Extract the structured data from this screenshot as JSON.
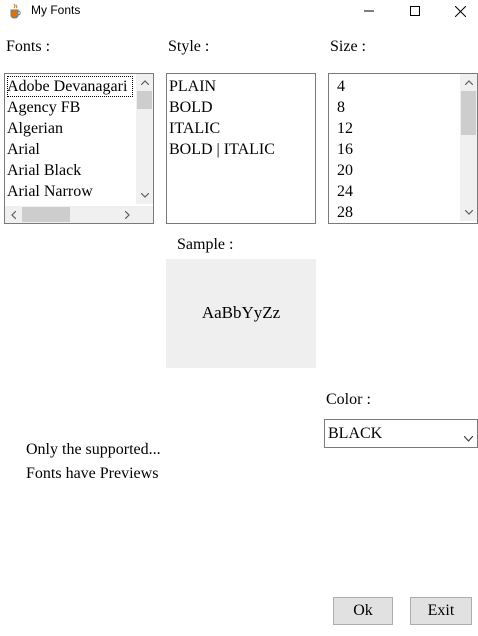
{
  "window": {
    "title": "My Fonts"
  },
  "labels": {
    "fonts": "Fonts :",
    "style": "Style :",
    "size": "Size :",
    "sample": "Sample :",
    "color": "Color :"
  },
  "fonts_list": {
    "items": [
      "Adobe Devanagari",
      "Agency FB",
      "Algerian",
      "Arial",
      "Arial Black",
      "Arial Narrow"
    ],
    "selected": "Adobe Devanagari"
  },
  "style_list": {
    "items": [
      "PLAIN",
      "BOLD",
      "ITALIC",
      "BOLD | ITALIC"
    ]
  },
  "size_list": {
    "items": [
      "4",
      "8",
      "12",
      "16",
      "20",
      "24",
      "28"
    ]
  },
  "sample": {
    "text": "AaBbYyZz"
  },
  "color": {
    "selected": "BLACK"
  },
  "note": {
    "line1": "Only the supported...",
    "line2": "Fonts have Previews"
  },
  "buttons": {
    "ok": "Ok",
    "exit": "Exit"
  },
  "icons": {
    "app": "java-coffee-icon",
    "minimize": "minimize-icon",
    "maximize": "maximize-icon",
    "close": "close-icon"
  }
}
